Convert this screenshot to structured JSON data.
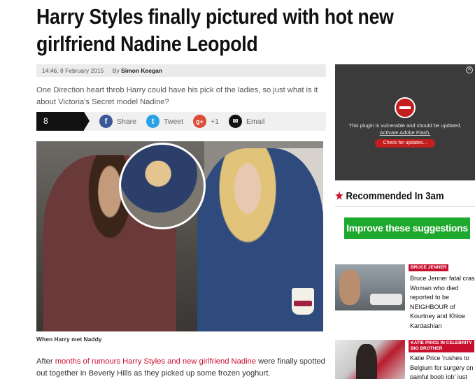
{
  "article": {
    "headline": "Harry Styles finally pictured with hot new girlfriend Nadine Leopold",
    "timestamp": "14:46, 8 February 2015",
    "by_label": "By",
    "author": "Simon Keegan",
    "standfirst": "One Direction heart throb Harry could have his pick of the ladies, so just what is it about Victoria's Secret model Nadine?",
    "image_caption": "When Harry met Naddy",
    "body_before_link": "After ",
    "body_link": "months of rumours Harry Styles and new girlfriend Nadine",
    "body_after_link": " were finally spotted out together in Beverly Hills as they picked up some frozen yoghurt.",
    "cup_brand": "GoGreek"
  },
  "share_bar": {
    "count_label": "8 Shares",
    "facebook": {
      "icon": "facebook-icon",
      "glyph": "f",
      "label": "Share"
    },
    "twitter": {
      "icon": "twitter-icon",
      "glyph": "t",
      "label": "Tweet"
    },
    "googleplus": {
      "icon": "google-plus-icon",
      "glyph": "g+",
      "label": "+1"
    },
    "email": {
      "icon": "email-icon",
      "glyph": "✉",
      "label": "Email"
    }
  },
  "plugin_notice": {
    "message": "This plugin is vulnerable and should be updated.",
    "activate_link": "Activate Adobe Flash.",
    "check_button": "Check for updates...",
    "close_glyph": "✕"
  },
  "sidebar": {
    "recommended_star": "★",
    "recommended_title": "Recommended In 3am",
    "improve_button": "Improve these suggestions",
    "teasers": [
      {
        "tag": "BRUCE JENNER",
        "lines": [
          "Bruce Jenner fatal cras",
          "Woman who died",
          "reported to be",
          "NEIGHBOUR of",
          "Kourtney and Khloe",
          "Kardashian"
        ]
      },
      {
        "tag": "KATIE PRICE IN CELEBRITY BIG BROTHER",
        "lines": [
          "Katie Price 'rushes to",
          "Belgium for surgery on",
          "painful boob job' just"
        ]
      }
    ]
  },
  "colors": {
    "accent_red": "#c8102e",
    "facebook_blue": "#3b5998",
    "twitter_blue": "#2aa3e6",
    "improve_green": "#1fa82e"
  }
}
